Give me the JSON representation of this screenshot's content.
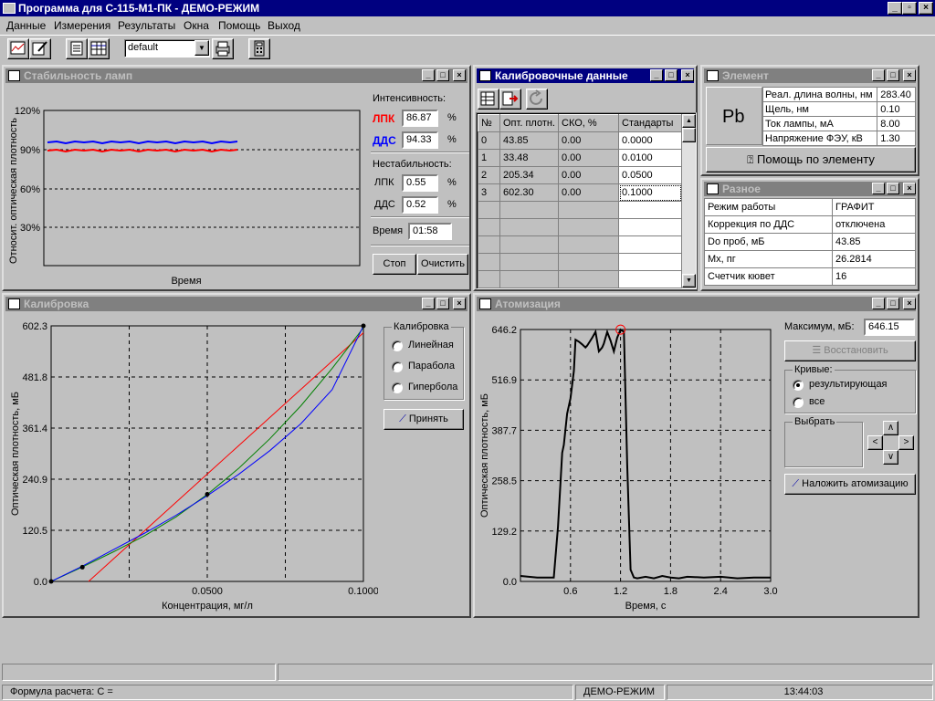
{
  "app": {
    "title": "Программа для С-115-М1-ПК - ДЕМО-РЕЖИМ"
  },
  "menu": [
    "Данные",
    "Измерения",
    "Результаты",
    "Окна",
    "Помощь",
    "Выход"
  ],
  "toolbar": {
    "profile": "default"
  },
  "stability": {
    "title": "Стабильность ламп",
    "ylabel": "Относит. оптическая плотность",
    "xlabel": "Время",
    "yticks": [
      "120%",
      "90%",
      "60%",
      "30%"
    ],
    "intensity_label": "Интенсивность:",
    "lpk_label": "ЛПК",
    "lpk_value": "86.87",
    "dds_label": "ДДС",
    "dds_value": "94.33",
    "percent": "%",
    "instability_label": "Нестабильность:",
    "lpk2_label": "ЛПК",
    "lpk2_value": "0.55",
    "dds2_label": "ДДС",
    "dds2_value": "0.52",
    "time_label": "Время",
    "time_value": "01:58",
    "stop": "Стоп",
    "clear": "Очистить",
    "colors": {
      "lpk": "#ff0000",
      "dds": "#0000ff"
    }
  },
  "calib_data": {
    "title": "Калибровочные данные",
    "headers": [
      "№",
      "Опт. плотн.",
      "СКО, %",
      "Стандарты"
    ],
    "rows": [
      [
        "0",
        "43.85",
        "0.00",
        "0.0000"
      ],
      [
        "1",
        "33.48",
        "0.00",
        "0.0100"
      ],
      [
        "2",
        "205.34",
        "0.00",
        "0.0500"
      ],
      [
        "3",
        "602.30",
        "0.00",
        "0.1000"
      ]
    ]
  },
  "element": {
    "title": "Элемент",
    "symbol": "Pb",
    "params": [
      [
        "Реал. длина волны, нм",
        "283.40"
      ],
      [
        "Щель, нм",
        "0.10"
      ],
      [
        "Ток лампы, мА",
        "8.00"
      ],
      [
        "Напряжение ФЭУ, кВ",
        "1.30"
      ]
    ],
    "help_button": "Помощь по элементу"
  },
  "misc": {
    "title": "Разное",
    "rows": [
      [
        "Режим работы",
        "ГРАФИТ"
      ],
      [
        "Коррекция по ДДС",
        "отключена"
      ],
      [
        "Do проб, мБ",
        "43.85"
      ],
      [
        "Mx, пг",
        "26.2814"
      ],
      [
        "Счетчик кювет",
        "16"
      ]
    ]
  },
  "calibration": {
    "title": "Калибровка",
    "group_label": "Калибровка",
    "options": [
      "Линейная",
      "Парабола",
      "Гипербола"
    ],
    "accept": "Принять"
  },
  "atomization": {
    "title": "Атомизация",
    "max_label": "Максимум, мБ:",
    "max_value": "646.15",
    "restore": "Восстановить",
    "curves_label": "Кривые:",
    "curve_options": [
      "результирующая",
      "все"
    ],
    "select_label": "Выбрать",
    "overlay": "Наложить атомизацию"
  },
  "chart_data": [
    {
      "type": "line",
      "title": "Калибровка",
      "xlabel": "Концентрация, мг/л",
      "ylabel": "Оптическая плотность, мБ",
      "xlim": [
        0,
        0.1
      ],
      "ylim": [
        0,
        602.3
      ],
      "xticks": [
        "0.0500",
        "0.1000"
      ],
      "yticks": [
        "602.3",
        "481.8",
        "361.4",
        "240.9",
        "120.5",
        "0.0"
      ],
      "points": [
        [
          0,
          0
        ],
        [
          0.01,
          33.48
        ],
        [
          0.05,
          205.34
        ],
        [
          0.1,
          602.3
        ]
      ],
      "series": [
        {
          "color": "#ff0000",
          "x": [
            0.012,
            0.1
          ],
          "y": [
            0,
            586
          ]
        },
        {
          "color": "#008000",
          "x": [
            0,
            0.01,
            0.02,
            0.03,
            0.04,
            0.05,
            0.06,
            0.07,
            0.08,
            0.09,
            0.1
          ],
          "y": [
            0,
            34,
            70,
            108,
            152,
            205,
            266,
            336,
            414,
            502,
            598
          ]
        },
        {
          "color": "#0000ff",
          "x": [
            0,
            0.01,
            0.02,
            0.03,
            0.04,
            0.05,
            0.06,
            0.07,
            0.08,
            0.09,
            0.1
          ],
          "y": [
            0,
            36,
            75,
            114,
            156,
            202,
            252,
            308,
            372,
            452,
            602
          ]
        }
      ],
      "grid": true
    },
    {
      "type": "line",
      "title": "Атомизация",
      "xlabel": "Время, с",
      "ylabel": "Оптическая плотность, мБ",
      "xlim": [
        0,
        3.0
      ],
      "ylim": [
        0,
        646.2
      ],
      "xticks": [
        "0.6",
        "1.2",
        "1.8",
        "2.4",
        "3.0"
      ],
      "yticks": [
        "646.2",
        "516.9",
        "387.7",
        "258.5",
        "129.2",
        "0.0"
      ],
      "series": [
        {
          "color": "#000000",
          "x": [
            0.0,
            0.2,
            0.4,
            0.45,
            0.5,
            0.52,
            0.56,
            0.6,
            0.64,
            0.66,
            0.7,
            0.74,
            0.78,
            0.8,
            0.86,
            0.9,
            0.94,
            0.98,
            1.0,
            1.04,
            1.08,
            1.12,
            1.16,
            1.2,
            1.24,
            1.28,
            1.32,
            1.36,
            1.4,
            1.5,
            1.6,
            1.7,
            1.8,
            1.9,
            2.0,
            2.2,
            2.4,
            2.6,
            2.8,
            3.0
          ],
          "y": [
            14,
            10,
            10,
            140,
            330,
            350,
            430,
            470,
            540,
            620,
            615,
            608,
            600,
            605,
            625,
            640,
            590,
            600,
            610,
            640,
            618,
            590,
            625,
            646,
            640,
            300,
            30,
            10,
            8,
            12,
            8,
            14,
            10,
            8,
            12,
            10,
            12,
            8,
            10,
            10
          ]
        }
      ],
      "marker": [
        1.2,
        646
      ],
      "grid": true
    }
  ],
  "status": {
    "formula": "Формула расчета: C =",
    "mode": "ДЕМО-РЕЖИМ",
    "time": "13:44:03"
  }
}
